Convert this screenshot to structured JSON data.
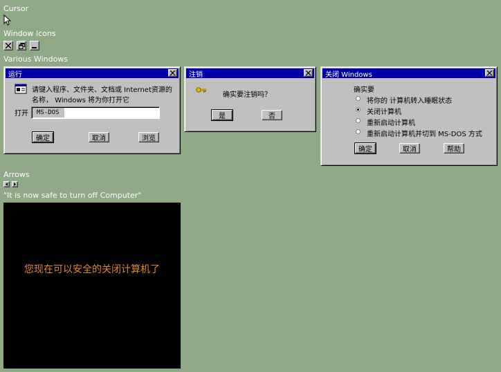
{
  "labels": {
    "cursor": "Cursor",
    "window_icons": "Window Icons",
    "various_windows": "Various Windows",
    "arrows": "Arrows",
    "safe_off": "\"It is now safe to turn off Computer\""
  },
  "icons": {
    "cursor": "arrow-cursor-icon",
    "close": "close-icon",
    "restore": "restore-icon",
    "minimize": "minimize-icon",
    "arrow_left": "arrow-left-icon",
    "arrow_right": "arrow-right-icon"
  },
  "run_dialog": {
    "title": "运行",
    "desc_line1": "请键入程序、文件夹、文档或 Internet资源的",
    "desc_line2": "名称， Windows 将为你打开它",
    "open_label": "打开",
    "open_value": "MS-DOS",
    "ok": "确定",
    "cancel": "取消",
    "browse": "浏览"
  },
  "logoff_dialog": {
    "title": "注销",
    "message": "确实要注销吗？",
    "yes": "是",
    "no": "否"
  },
  "shutdown_dialog": {
    "title": "关闭 Windows",
    "prompt": "确实要",
    "options": [
      {
        "label": "将你的 计算机转入睡眠状态",
        "selected": false
      },
      {
        "label": "关闭计算机",
        "selected": true
      },
      {
        "label": "重新启动计算机",
        "selected": false
      },
      {
        "label": "重新启动计算机并切到 MS-DOS 方式",
        "selected": false
      }
    ],
    "ok": "确定",
    "cancel": "取消",
    "help": "帮助"
  },
  "safe_screen": {
    "message": "您现在可以安全的关闭计算机了",
    "text_color": "#e08a1e",
    "background": "#000000"
  },
  "colors": {
    "desktop": "#8fa987",
    "titlebar": "#0000a8",
    "face": "#c0c0c0"
  }
}
